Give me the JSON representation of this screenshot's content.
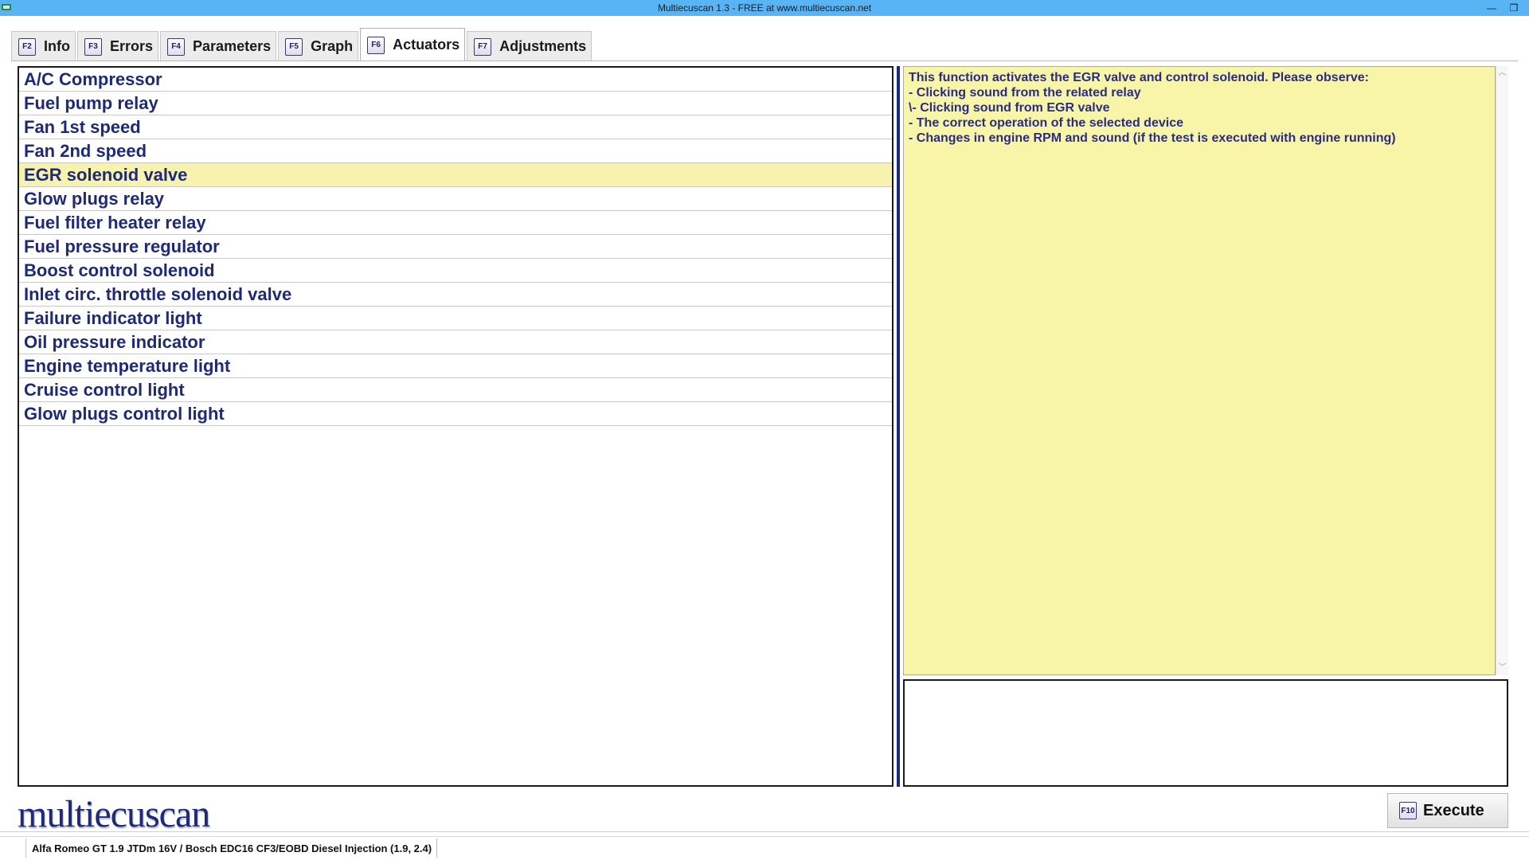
{
  "window": {
    "title": "Multiecuscan 1.3 - FREE at www.multiecuscan.net",
    "minimize_label": "—",
    "restore_label": "❐",
    "close_label": "✕"
  },
  "tabs": [
    {
      "key": "F2",
      "label": "Info"
    },
    {
      "key": "F3",
      "label": "Errors"
    },
    {
      "key": "F4",
      "label": "Parameters"
    },
    {
      "key": "F5",
      "label": "Graph"
    },
    {
      "key": "F6",
      "label": "Actuators"
    },
    {
      "key": "F7",
      "label": "Adjustments"
    }
  ],
  "actuators": {
    "items": [
      "A/C Compressor",
      "Fuel pump relay",
      "Fan 1st speed",
      "Fan 2nd speed",
      "EGR solenoid valve",
      "Glow plugs relay",
      "Fuel filter heater relay",
      "Fuel pressure regulator",
      "Boost control solenoid",
      "Inlet circ. throttle solenoid valve",
      "Failure indicator light",
      "Oil pressure indicator",
      "Engine temperature light",
      "Cruise control light",
      "Glow plugs control light"
    ],
    "selected": "EGR solenoid valve"
  },
  "description": {
    "lines": [
      "This function activates the EGR valve and control solenoid. Please observe:",
      "- Clicking sound from the related relay",
      "\\- Clicking sound from EGR valve",
      "- The correct operation of the selected device",
      "- Changes in engine RPM and sound (if the test is executed with engine running)"
    ]
  },
  "logo": {
    "text": "multiecuscan"
  },
  "execute": {
    "key": "F10",
    "label": "Execute"
  },
  "status": {
    "vehicle": "Alfa Romeo GT 1.9 JTDm 16V / Bosch EDC16 CF3/EOBD Diesel Injection (1.9, 2.4)"
  },
  "colors": {
    "titlebar": "#59b4f5",
    "list_text": "#1e2a78",
    "selected_row": "#f7f3ae",
    "description_bg": "#f8f5a9",
    "description_text": "#2a2c84"
  }
}
